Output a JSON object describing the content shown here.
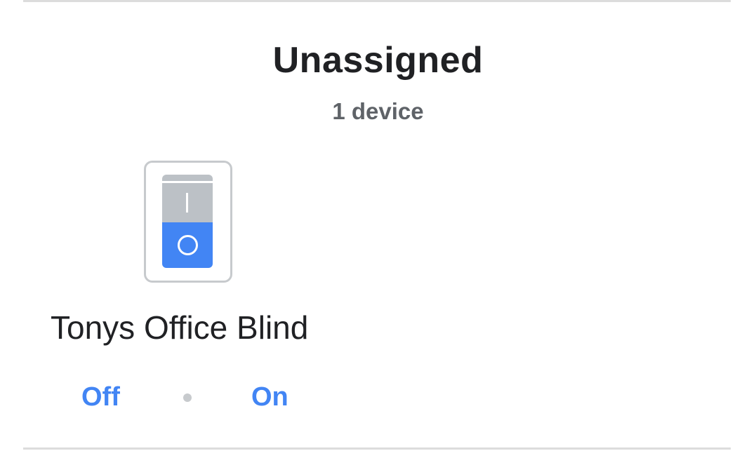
{
  "section": {
    "title": "Unassigned",
    "count": "1 device"
  },
  "device": {
    "name": "Tonys Office Blind",
    "icon": "rocker-switch-icon",
    "state": "off"
  },
  "actions": {
    "off_label": "Off",
    "on_label": "On"
  },
  "colors": {
    "accent": "#4285f4",
    "title": "#202124",
    "subtitle": "#5f6368",
    "switch_top": "#bcc1c6",
    "tile_border": "#c7cacd"
  }
}
